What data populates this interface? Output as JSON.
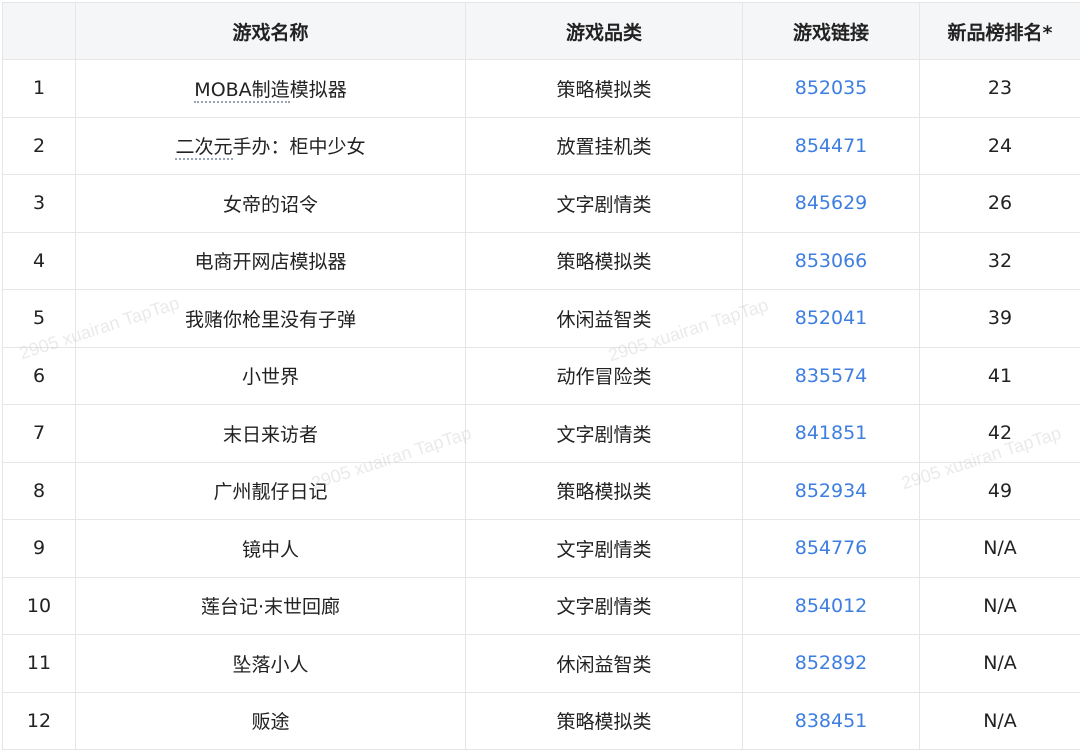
{
  "table": {
    "headers": [
      "",
      "游戏名称",
      "游戏品类",
      "游戏链接",
      "新品榜排名*"
    ],
    "rows": [
      {
        "index": "1",
        "name": "MOBA制造模拟器",
        "dotted_prefix": "MOBA制造",
        "rest": "模拟器",
        "category": "策略模拟类",
        "link": "852035",
        "rank": "23"
      },
      {
        "index": "2",
        "name": "二次元手办：柜中少女",
        "dotted_prefix": "二次元",
        "rest": "手办：柜中少女",
        "category": "放置挂机类",
        "link": "854471",
        "rank": "24"
      },
      {
        "index": "3",
        "name": "女帝的诏令",
        "category": "文字剧情类",
        "link": "845629",
        "rank": "26"
      },
      {
        "index": "4",
        "name": "电商开网店模拟器",
        "category": "策略模拟类",
        "link": "853066",
        "rank": "32"
      },
      {
        "index": "5",
        "name": "我赌你枪里没有子弹",
        "category": "休闲益智类",
        "link": "852041",
        "rank": "39"
      },
      {
        "index": "6",
        "name": "小世界",
        "category": "动作冒险类",
        "link": "835574",
        "rank": "41"
      },
      {
        "index": "7",
        "name": "末日来访者",
        "category": "文字剧情类",
        "link": "841851",
        "rank": "42"
      },
      {
        "index": "8",
        "name": "广州靓仔日记",
        "category": "策略模拟类",
        "link": "852934",
        "rank": "49"
      },
      {
        "index": "9",
        "name": "镜中人",
        "category": "文字剧情类",
        "link": "854776",
        "rank": "N/A"
      },
      {
        "index": "10",
        "name": "莲台记·末世回廊",
        "category": "文字剧情类",
        "link": "854012",
        "rank": "N/A"
      },
      {
        "index": "11",
        "name": "坠落小人",
        "category": "休闲益智类",
        "link": "852892",
        "rank": "N/A"
      },
      {
        "index": "12",
        "name": "贩途",
        "category": "策略模拟类",
        "link": "838451",
        "rank": "N/A"
      }
    ]
  },
  "watermark": "2905 xuairan TapTap",
  "colors": {
    "header_bg": "#f5f6f8",
    "border": "#e6e6e6",
    "link": "#3d7ee0",
    "text": "#222222"
  }
}
